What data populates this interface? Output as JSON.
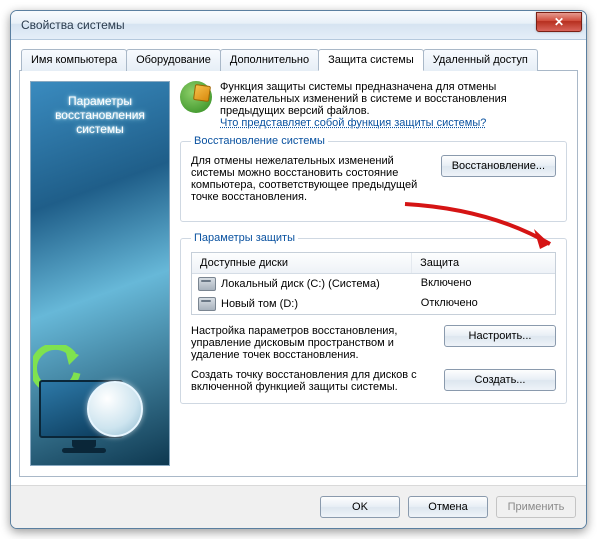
{
  "window": {
    "title": "Свойства системы"
  },
  "tabs": [
    {
      "label": "Имя компьютера"
    },
    {
      "label": "Оборудование"
    },
    {
      "label": "Дополнительно"
    },
    {
      "label": "Защита системы"
    },
    {
      "label": "Удаленный доступ"
    }
  ],
  "sidebar": {
    "line1": "Параметры",
    "line2": "восстановления",
    "line3": "системы"
  },
  "intro": {
    "text": "Функция защиты системы предназначена для отмены нежелательных изменений в системе и восстановления предыдущих версий файлов.",
    "link": "Что представляет собой функция защиты системы?"
  },
  "restore": {
    "legend": "Восстановление системы",
    "desc": "Для отмены нежелательных изменений системы можно восстановить состояние компьютера, соответствующее предыдущей точке восстановления.",
    "button": "Восстановление..."
  },
  "protection": {
    "legend": "Параметры защиты",
    "col_disk": "Доступные диски",
    "col_state": "Защита",
    "rows": [
      {
        "name": "Локальный диск (C:) (Система)",
        "state": "Включено"
      },
      {
        "name": "Новый том (D:)",
        "state": "Отключено"
      }
    ],
    "configure_desc": "Настройка параметров восстановления, управление дисковым пространством и удаление точек восстановления.",
    "configure_btn": "Настроить...",
    "create_desc": "Создать точку восстановления для дисков с включенной функцией защиты системы.",
    "create_btn": "Создать..."
  },
  "footer": {
    "ok": "OK",
    "cancel": "Отмена",
    "apply": "Применить"
  }
}
